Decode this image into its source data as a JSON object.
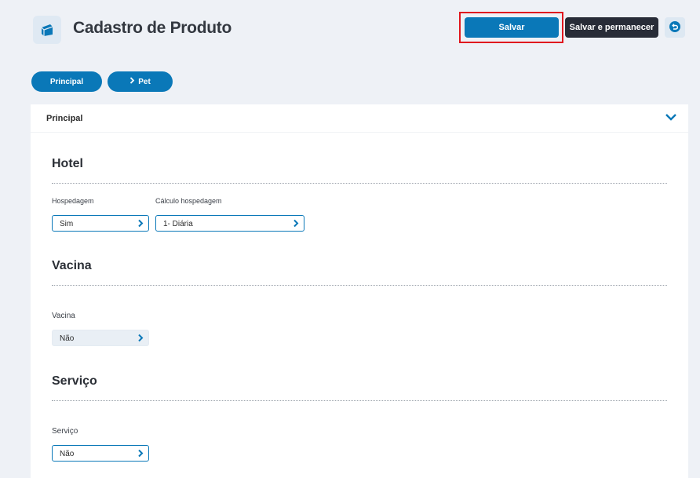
{
  "header": {
    "title": "Cadastro de Produto",
    "icon": "product-box-icon",
    "save_label": "Salvar",
    "save_stay_label": "Salvar e permanecer",
    "undo_icon": "undo-icon"
  },
  "tabs": [
    {
      "label": "Principal"
    },
    {
      "label": "Pet",
      "icon": "chevron-right-icon"
    }
  ],
  "panel": {
    "title": "Principal",
    "toggle_icon": "chevron-down-icon"
  },
  "sections": {
    "hotel": {
      "title": "Hotel",
      "hospedagem_label": "Hospedagem",
      "hospedagem_value": "Sim",
      "calculo_label": "Cálculo hospedagem",
      "calculo_value": "1- Diária"
    },
    "vacina": {
      "title": "Vacina",
      "vacina_label": "Vacina",
      "vacina_value": "Não"
    },
    "servico": {
      "title": "Serviço",
      "servico_label": "Serviço",
      "servico_value": "Não"
    }
  },
  "colors": {
    "accent": "#0a78b8",
    "dark_button": "#282c37",
    "highlight": "#e0161e",
    "background": "#eef1f6"
  }
}
